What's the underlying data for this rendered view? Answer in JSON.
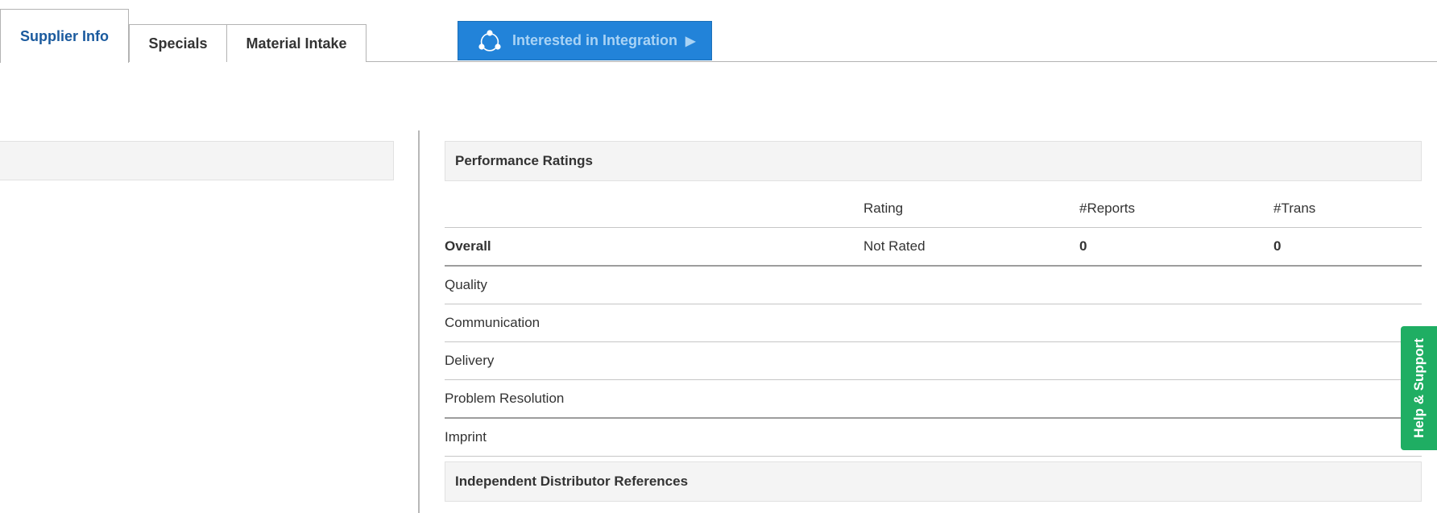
{
  "tabs": [
    {
      "label": "Supplier Info",
      "active": true
    },
    {
      "label": "Specials",
      "active": false
    },
    {
      "label": "Material Intake",
      "active": false
    }
  ],
  "integration_button": {
    "label": "Interested in Integration",
    "icon": "share-icon",
    "arrow_icon": "play-icon"
  },
  "performance": {
    "title": "Performance Ratings",
    "columns": [
      "",
      "Rating",
      "#Reports",
      "#Trans"
    ],
    "overall": {
      "label": "Overall",
      "rating": "Not Rated",
      "reports": "0",
      "trans": "0"
    },
    "rows": [
      "Quality",
      "Communication",
      "Delivery",
      "Problem Resolution",
      "Imprint"
    ]
  },
  "distributor_references": {
    "title": "Independent Distributor References"
  },
  "help_support": {
    "label": "Help & Support"
  },
  "colors": {
    "active_tab_text": "#1a5a9e",
    "integration_bg": "#2283d9",
    "integration_text": "#a9d3f5",
    "help_bg": "#1fae63",
    "panel_header_bg": "#f4f4f4"
  }
}
